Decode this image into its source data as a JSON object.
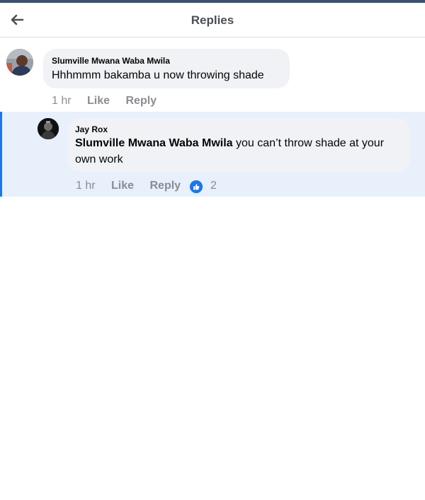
{
  "header": {
    "title": "Replies"
  },
  "comment": {
    "author": "Slumville Mwana Waba Mwila",
    "text": "Hhhmmm bakamba u now throwing shade",
    "time": "1 hr",
    "like_label": "Like",
    "reply_label": "Reply"
  },
  "reply": {
    "author": "Jay Rox",
    "mention": "Slumville Mwana Waba Mwila",
    "text": " you can’t throw shade at your own work",
    "time": "1 hr",
    "like_label": "Like",
    "reply_label": "Reply",
    "reaction_icon": "like-icon",
    "reaction_count": "2"
  },
  "colors": {
    "accent": "#1877f2",
    "bubble": "#f0f2f5",
    "highlight": "#e7f0fb"
  }
}
